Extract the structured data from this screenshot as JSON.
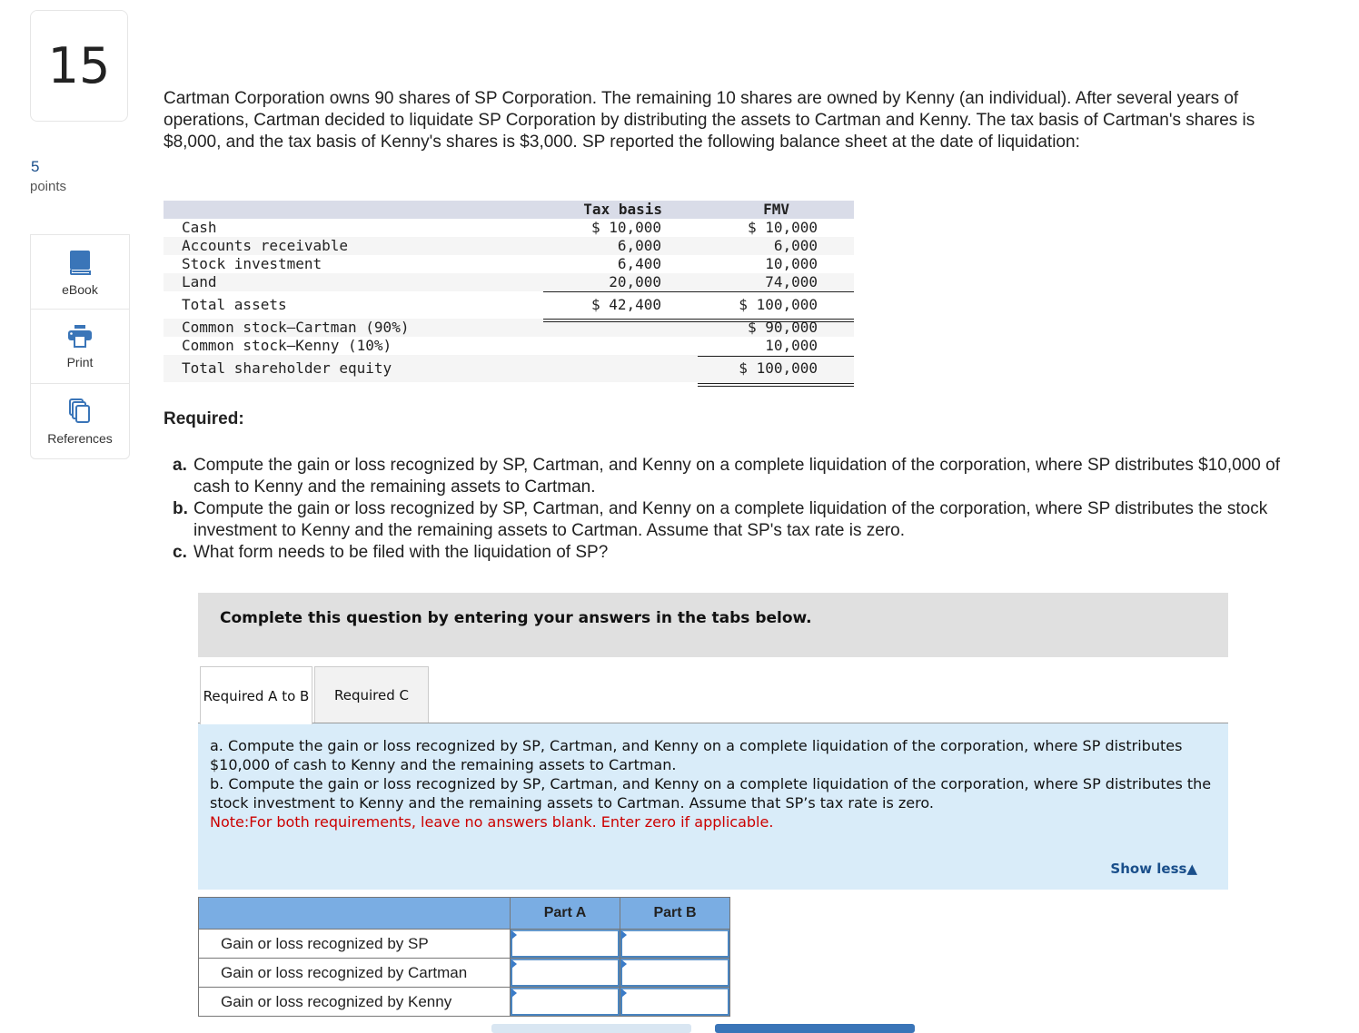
{
  "question": {
    "number": "15",
    "points_value": "5",
    "points_label": "points"
  },
  "tools": [
    {
      "label": "eBook",
      "icon": "book-icon"
    },
    {
      "label": "Print",
      "icon": "printer-icon"
    },
    {
      "label": "References",
      "icon": "copy-pages-icon"
    }
  ],
  "intro": "Cartman Corporation owns 90 shares of SP Corporation. The remaining 10 shares are owned by Kenny (an individual). After several years of operations, Cartman decided to liquidate SP Corporation by distributing the assets to Cartman and Kenny. The tax basis of Cartman's shares is $8,000, and the tax basis of Kenny's shares is $3,000. SP reported the following balance sheet at the date of liquidation:",
  "balance_sheet": {
    "headers": {
      "tax_basis": "Tax basis",
      "fmv": "FMV"
    },
    "assets": [
      {
        "label": "Cash",
        "tax_basis": "$ 10,000",
        "fmv": "$ 10,000"
      },
      {
        "label": "Accounts receivable",
        "tax_basis": "6,000",
        "fmv": "6,000"
      },
      {
        "label": "Stock investment",
        "tax_basis": "6,400",
        "fmv": "10,000"
      },
      {
        "label": "Land",
        "tax_basis": "20,000",
        "fmv": "74,000"
      }
    ],
    "total_assets": {
      "label": "Total assets",
      "tax_basis": "$ 42,400",
      "fmv": "$ 100,000"
    },
    "equity": [
      {
        "label": "Common stock—Cartman (90%)",
        "fmv": "$ 90,000"
      },
      {
        "label": "Common stock—Kenny (10%)",
        "fmv": "10,000"
      }
    ],
    "total_equity": {
      "label": "Total shareholder equity",
      "fmv": "$ 100,000"
    }
  },
  "required": {
    "heading": "Required:",
    "items": [
      {
        "key": "a.",
        "text": "Compute the gain or loss recognized by SP, Cartman, and Kenny on a complete liquidation of the corporation, where SP distributes $10,000 of cash to Kenny and the remaining assets to Cartman."
      },
      {
        "key": "b.",
        "text": "Compute the gain or loss recognized by SP, Cartman, and Kenny on a complete liquidation of the corporation, where SP distributes the stock investment to Kenny and the remaining assets to Cartman. Assume that SP's tax rate is zero."
      },
      {
        "key": "c.",
        "text": "What form needs to be filed with the liquidation of SP?"
      }
    ]
  },
  "banner": "Complete this question by entering your answers in the tabs below.",
  "tabs": [
    {
      "label": "Required A to B",
      "active": true
    },
    {
      "label": "Required C",
      "active": false
    }
  ],
  "panel": {
    "line_a": "a. Compute the gain or loss recognized by SP, Cartman, and Kenny on a complete liquidation of the corporation, where SP distributes $10,000 of cash to Kenny and the remaining assets to Cartman.",
    "line_b": "b. Compute the gain or loss recognized by SP, Cartman, and Kenny on a complete liquidation of the corporation, where SP distributes the stock investment to Kenny and the remaining assets to Cartman. Assume that SP’s tax rate is zero.",
    "note": "Note:For both requirements, leave no answers blank. Enter zero if applicable.",
    "show_less": "Show less▲"
  },
  "answer_table": {
    "columns": [
      "",
      "Part A",
      "Part B"
    ],
    "rows": [
      {
        "label": "Gain or loss recognized by SP",
        "part_a": "",
        "part_b": ""
      },
      {
        "label": "Gain or loss recognized by Cartman",
        "part_a": "",
        "part_b": ""
      },
      {
        "label": "Gain or loss recognized by Kenny",
        "part_a": "",
        "part_b": ""
      }
    ]
  },
  "colors": {
    "accent": "#1a4f8b",
    "icon_blue": "#3a75b8",
    "table_header": "#7aade3",
    "panel_bg": "#d9ecf9",
    "note_red": "#cc0000"
  }
}
